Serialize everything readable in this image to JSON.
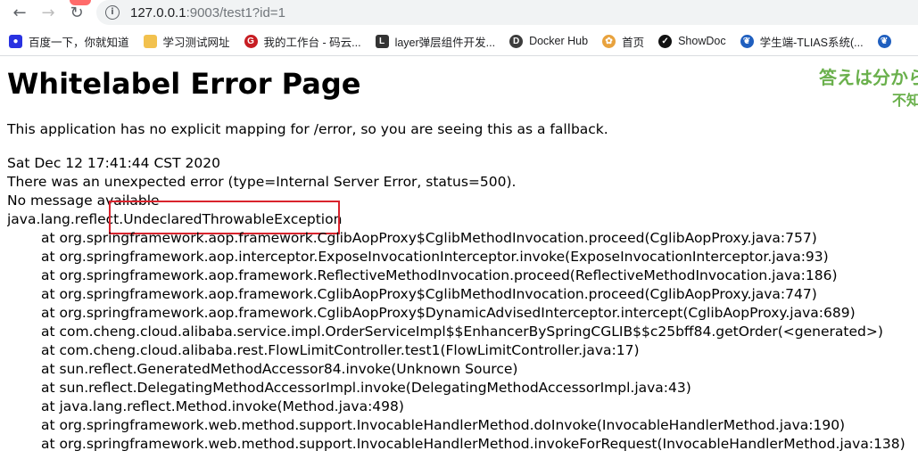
{
  "browser": {
    "url_host": "127.0.0.1",
    "url_rest": ":9003/test1?id=1",
    "bookmarks": [
      {
        "label": "百度一下，你就知道",
        "icon": "baidu-icon",
        "color": "#2932e1"
      },
      {
        "label": "学习测试网址",
        "icon": "folder-icon",
        "color": "#f2c14e"
      },
      {
        "label": "我的工作台 - 码云...",
        "icon": "gitee-icon",
        "color": "#c71d23"
      },
      {
        "label": "layer弹层组件开发...",
        "icon": "layer-icon",
        "color": "#333333"
      },
      {
        "label": "Docker Hub",
        "icon": "docker-icon",
        "color": "#3c3c3c"
      },
      {
        "label": "首页",
        "icon": "home-logo-icon",
        "color": "#e8a23d"
      },
      {
        "label": "ShowDoc",
        "icon": "showdoc-icon",
        "color": "#111111"
      },
      {
        "label": "学生端-TLIAS系统(...",
        "icon": "tlias-icon",
        "color": "#1f5fbf"
      },
      {
        "label": "",
        "icon": "tlias-icon-2",
        "color": "#1f5fbf"
      }
    ]
  },
  "page": {
    "title": "Whitelabel Error Page",
    "fallback": "This application has no explicit mapping for /error, so you are seeing this as a fallback.",
    "date": "Sat Dec 12 17:41:44 CST 2020",
    "error": "There was an unexpected error (type=Internal Server Error, status=500).",
    "message": "No message available",
    "exception": "java.lang.reflect.UndeclaredThrowableException",
    "trace": [
      "at org.springframework.aop.framework.CglibAopProxy$CglibMethodInvocation.proceed(CglibAopProxy.java:757)",
      "at org.springframework.aop.interceptor.ExposeInvocationInterceptor.invoke(ExposeInvocationInterceptor.java:93)",
      "at org.springframework.aop.framework.ReflectiveMethodInvocation.proceed(ReflectiveMethodInvocation.java:186)",
      "at org.springframework.aop.framework.CglibAopProxy$CglibMethodInvocation.proceed(CglibAopProxy.java:747)",
      "at org.springframework.aop.framework.CglibAopProxy$DynamicAdvisedInterceptor.intercept(CglibAopProxy.java:689)",
      "at com.cheng.cloud.alibaba.service.impl.OrderServiceImpl$$EnhancerBySpringCGLIB$$c25bff84.getOrder(<generated>)",
      "at com.cheng.cloud.alibaba.rest.FlowLimitController.test1(FlowLimitController.java:17)",
      "at sun.reflect.GeneratedMethodAccessor84.invoke(Unknown Source)",
      "at sun.reflect.DelegatingMethodAccessorImpl.invoke(DelegatingMethodAccessorImpl.java:43)",
      "at java.lang.reflect.Method.invoke(Method.java:498)",
      "at org.springframework.web.method.support.InvocableHandlerMethod.doInvoke(InvocableHandlerMethod.java:190)",
      "at org.springframework.web.method.support.InvocableHandlerMethod.invokeForRequest(InvocableHandlerMethod.java:138)"
    ],
    "overlay_text": "答えは分から",
    "overlay_text_2": "不知"
  }
}
